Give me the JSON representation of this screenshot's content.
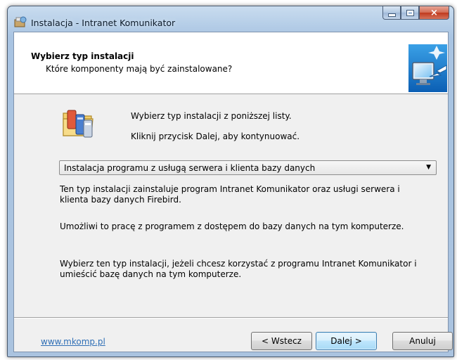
{
  "window": {
    "title": "Instalacja - Intranet Komunikator",
    "close_glyph": "×",
    "icons": {
      "app": "installer-app-icon",
      "minimize": "minimize-icon",
      "maximize": "maximize-icon",
      "close": "close-icon"
    }
  },
  "header": {
    "title": "Wybierz typ instalacji",
    "subtitle": "Które komponenty mają być zainstalowane?",
    "image": "wizard-computer-icon"
  },
  "main": {
    "icon": "components-folder-icon",
    "intro_line1": "Wybierz typ instalacji z poniższej listy.",
    "intro_line2": "Kliknij przycisk Dalej, aby kontynuować.",
    "install_type": {
      "selected": "Instalacja programu z usługą serwera i klienta bazy danych",
      "arrow": "▼"
    },
    "description_1": "Ten typ instalacji zainstaluje program Intranet Komunikator oraz usługi serwera i klienta bazy danych Firebird.",
    "description_2": "Umożliwi to pracę z programem z dostępem do bazy danych na tym komputerze.",
    "description_3": "Wybierz ten typ instalacji, jeżeli chcesz korzystać z programu Intranet Komunikator i umieścić bazę danych na tym komputerze."
  },
  "footer": {
    "link": "www.mkomp.pl",
    "back_label": "< Wstecz",
    "next_label": "Dalej >",
    "cancel_label": "Anuluj"
  },
  "colors": {
    "link": "#2f6fb6",
    "close_button": "#c0391d",
    "default_button_border": "#3c7fb1"
  }
}
